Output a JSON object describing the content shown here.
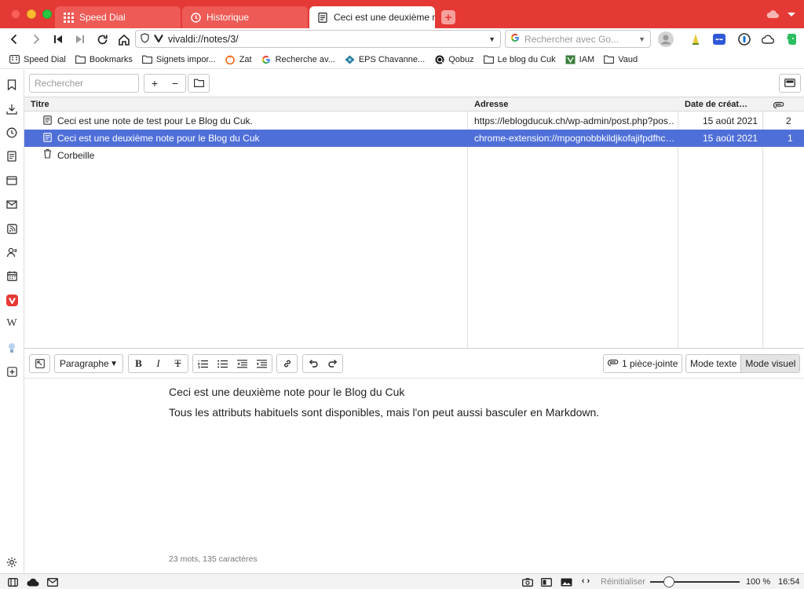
{
  "tabs": [
    {
      "label": "Speed Dial",
      "icon": "grid-icon"
    },
    {
      "label": "Historique",
      "icon": "clock-icon"
    },
    {
      "label": "Ceci est une deuxième note",
      "icon": "note-icon"
    }
  ],
  "address": {
    "url": "vivaldi://notes/3/",
    "search_placeholder": "Rechercher avec Go..."
  },
  "bookmarks": [
    {
      "label": "Speed Dial",
      "icon": "speed-dial-icon"
    },
    {
      "label": "Bookmarks",
      "icon": "folder-icon"
    },
    {
      "label": "Signets impor...",
      "icon": "folder-icon"
    },
    {
      "label": "Zat",
      "icon": "zat-icon"
    },
    {
      "label": "Recherche av...",
      "icon": "google-icon"
    },
    {
      "label": "EPS Chavanne...",
      "icon": "eps-icon"
    },
    {
      "label": "Qobuz",
      "icon": "qobuz-icon"
    },
    {
      "label": "Le blog du Cuk",
      "icon": "folder-icon"
    },
    {
      "label": "IAM",
      "icon": "iam-icon"
    },
    {
      "label": "Vaud",
      "icon": "folder-icon"
    }
  ],
  "notes_toolbar": {
    "search_placeholder": "Rechercher",
    "add_label": "+",
    "remove_label": "−"
  },
  "table": {
    "headers": {
      "title": "Titre",
      "address": "Adresse",
      "date": "Date de créat…",
      "attach": "attachments"
    },
    "rows": [
      {
        "title": "Ceci est une note de test pour Le Blog du Cuk.",
        "address": "https://leblogducuk.ch/wp-admin/post.php?pos…",
        "date": "15 août 2021",
        "count": "2",
        "selected": false
      },
      {
        "title": "Ceci est une deuxième note pour le Blog du Cuk",
        "address": "chrome-extension://mpognobbkildjkofajifpdfhc…",
        "date": "15 août 2021",
        "count": "1",
        "selected": true
      },
      {
        "title": "Corbeille",
        "address": "",
        "date": "",
        "count": "",
        "selected": false
      }
    ]
  },
  "editor": {
    "format_select": "Paragraphe",
    "attachments_label": "1 pièce-jointe",
    "mode_text": "Mode texte",
    "mode_visual": "Mode visuel",
    "line1": "Ceci est une deuxième note pour le Blog du Cuk",
    "line2": "Tous les attributs habituels sont disponibles, mais l'on peut aussi basculer en Markdown.",
    "word_count": "23 mots, 135 caractères"
  },
  "status": {
    "reset_label": "Réinitialiser",
    "zoom": "100 %",
    "time": "16:54",
    "zoom_level": 0.5
  },
  "colors": {
    "accent": "#e53935",
    "selection": "#4f6fd8"
  }
}
